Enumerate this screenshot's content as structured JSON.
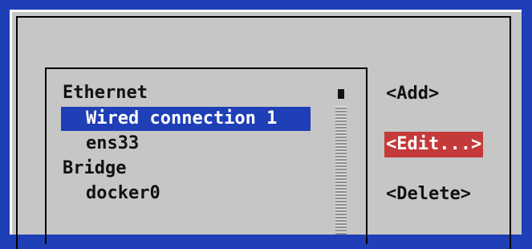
{
  "connection_list": {
    "items": [
      {
        "label": "Ethernet",
        "type": "group"
      },
      {
        "label": "Wired connection 1",
        "type": "connection",
        "selected": true
      },
      {
        "label": "ens33",
        "type": "connection"
      },
      {
        "label": "Bridge",
        "type": "group"
      },
      {
        "label": "docker0",
        "type": "connection"
      }
    ]
  },
  "buttons": {
    "add": "<Add>",
    "edit": "<Edit...>",
    "delete": "<Delete>"
  },
  "colors": {
    "background_blue": "#1f3fb7",
    "dialog_gray": "#c6c6c6",
    "active_button_red": "#c43a3a"
  }
}
